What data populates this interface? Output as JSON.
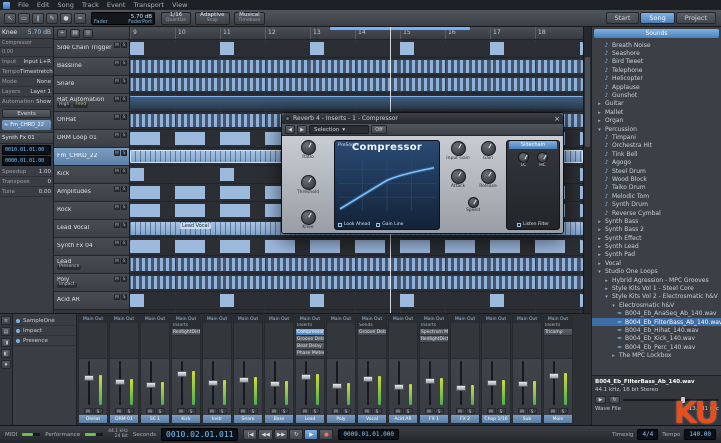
{
  "watermark": "KU",
  "menubar": {
    "items": [
      "File",
      "Edit",
      "Song",
      "Track",
      "Event",
      "Transport",
      "View"
    ]
  },
  "toolbar": {
    "tools": [
      "↖",
      "▭",
      "∥",
      "✎",
      "●",
      "≈"
    ],
    "link_value": "5.70 dB",
    "link_line1": "Fader",
    "link_line2": "FaderPort",
    "quantize_value": "1/16",
    "quantize_label": "Quantize",
    "snap_value": "Adaptive",
    "snap_label": "Snap",
    "timebase_value": "Musical",
    "timebase_label": "Timebase",
    "right_tabs": [
      {
        "label": "Start"
      },
      {
        "label": "Song",
        "cls": "active"
      },
      {
        "label": "Project"
      }
    ]
  },
  "inspector": {
    "param_name": "Knee",
    "param_value": "5.70 dB",
    "device_name": "Compressor",
    "param_min": "0.00",
    "input_label": "Input",
    "input_value": "Input L+R",
    "tempo_label": "Tempo",
    "tempo_value": "Timestretch",
    "mode_label": "Mode",
    "mode_value": "None",
    "layers_label": "Layers",
    "layers_value": "Layer 1",
    "automation_label": "Automation",
    "automation_value": "Show",
    "events_button": "Events",
    "clip_name": "Fm_CHRD_22",
    "section2_title": "Synth Fx 01",
    "pos1": "0010.01.01.00",
    "pos2": "0000.01.01.00",
    "fields": [
      {
        "label": "Speedup",
        "value": "1.00"
      },
      {
        "label": "Transpose",
        "value": "0"
      },
      {
        "label": "Tune",
        "value": "0.00"
      }
    ]
  },
  "tracklist": {
    "tools": [
      "+",
      "▤",
      "◎"
    ],
    "tracks": [
      {
        "name": "Side Chain Trigger",
        "cls": "patD"
      },
      {
        "name": "Bassline",
        "cls": "patA"
      },
      {
        "name": "Snare",
        "cls": "patA"
      },
      {
        "name": "Hat Automation",
        "badge": "High",
        "badge2": "Feed",
        "cls": "patE"
      },
      {
        "name": "OhHat",
        "cls": "patA"
      },
      {
        "name": "DRM Loop 01",
        "cls": "patB"
      },
      {
        "name": "Fm_CHRD_22",
        "cls": "patC selected"
      },
      {
        "name": "Kick",
        "cls": "patD"
      },
      {
        "name": "Amplitudes",
        "cls": "patB"
      },
      {
        "name": "Rock",
        "cls": "patB"
      },
      {
        "name": "Lead Vocal",
        "cls": "patC"
      },
      {
        "name": "Synth Fx 04",
        "cls": "patB"
      },
      {
        "name": "Lead",
        "badge": "Presence",
        "cls": "patA"
      },
      {
        "name": "Poly",
        "badge": "Impact",
        "cls": "patA"
      },
      {
        "name": "Acid AR",
        "cls": "patD"
      }
    ]
  },
  "ruler": [
    "9",
    "10",
    "11",
    "12",
    "13",
    "14",
    "15",
    "16",
    "17",
    "18"
  ],
  "arrange": {
    "clip_label": "Lead Vocal"
  },
  "plugin": {
    "title": "Reverb 4 - Inserts - 1 - Compressor",
    "preset": "Selection",
    "bypass": "Off",
    "brand": "PreSonus",
    "name": "Compressor",
    "knobs_left": [
      {
        "label": "Ratio"
      },
      {
        "label": "Threshold"
      },
      {
        "label": "Knee"
      }
    ],
    "knobs_right": [
      {
        "label": "Input Gain"
      },
      {
        "label": "Gain"
      },
      {
        "label": "Attack"
      },
      {
        "label": "Release"
      }
    ],
    "speed_label": "Speed",
    "options": [
      {
        "label": "Look Ahead"
      },
      {
        "label": "Gain Line"
      }
    ],
    "sidechain": {
      "title": "Sidechain",
      "knobs": [
        {
          "label": "LC"
        },
        {
          "label": "HC"
        }
      ],
      "listen": "Listen Filter"
    }
  },
  "browser": {
    "title": "Sounds",
    "items": [
      {
        "label": "Breath Noise",
        "cls": "sound ind1"
      },
      {
        "label": "Seashore",
        "cls": "sound ind1"
      },
      {
        "label": "Bird Tweet",
        "cls": "sound ind1"
      },
      {
        "label": "Telephone",
        "cls": "sound ind1"
      },
      {
        "label": "Helicopter",
        "cls": "sound ind1"
      },
      {
        "label": "Applause",
        "cls": "sound ind1"
      },
      {
        "label": "Gunshot",
        "cls": "sound ind1"
      },
      {
        "label": "Guitar",
        "cls": "folder ind0"
      },
      {
        "label": "Mallet",
        "cls": "folder ind0"
      },
      {
        "label": "Organ",
        "cls": "folder ind0"
      },
      {
        "label": "Percussion",
        "cls": "folder open ind0"
      },
      {
        "label": "Timpani",
        "cls": "sound ind1"
      },
      {
        "label": "Orchestra Hit",
        "cls": "sound ind1"
      },
      {
        "label": "Tink Bell",
        "cls": "sound ind1"
      },
      {
        "label": "Agogo",
        "cls": "sound ind1"
      },
      {
        "label": "Steel Drum",
        "cls": "sound ind1"
      },
      {
        "label": "Wood Block",
        "cls": "sound ind1"
      },
      {
        "label": "Taiko Drum",
        "cls": "sound ind1"
      },
      {
        "label": "Melodic Tom",
        "cls": "sound ind1"
      },
      {
        "label": "Synth Drum",
        "cls": "sound ind1"
      },
      {
        "label": "Reverse Cymbal",
        "cls": "sound ind1"
      },
      {
        "label": "Synth Bass",
        "cls": "folder ind0"
      },
      {
        "label": "Synth Bass 2",
        "cls": "folder ind0"
      },
      {
        "label": "Synth Effect",
        "cls": "folder ind0"
      },
      {
        "label": "Synth Lead",
        "cls": "folder ind0"
      },
      {
        "label": "Synth Pad",
        "cls": "folder ind0"
      },
      {
        "label": "Vocal",
        "cls": "folder ind0"
      },
      {
        "label": "Studio One Loops",
        "cls": "folder open ind0"
      },
      {
        "label": "Hybrid Agression - MPC Grooves",
        "cls": "folder ind1"
      },
      {
        "label": "Style Kits Vol 1 - Steel Core",
        "cls": "folder ind1"
      },
      {
        "label": "Style Kits Vol 2 - Electrosmatic h&V",
        "cls": "folder open ind1"
      },
      {
        "label": "Electrosmatic h&V",
        "cls": "folder open ind2"
      },
      {
        "label": "B004_Eb_AnaSeq_Ab_140.wav",
        "cls": "wave ind3"
      },
      {
        "label": "B004_Eb_FilterBass_Ab_140.wav",
        "cls": "wave ind3 selected"
      },
      {
        "label": "B004_Eb_Hihat_140.wav",
        "cls": "wave ind3"
      },
      {
        "label": "B004_Eb_Kick_140.wav",
        "cls": "wave ind3"
      },
      {
        "label": "B004_Eb_Perc_140.wav",
        "cls": "wave ind3"
      },
      {
        "label": "The MPC Lockbox",
        "cls": "folder ind2"
      }
    ],
    "file_info": {
      "name": "B004_Eb_FilterBass_Ab_140.wav",
      "format": "44.1 kHz, 16 bit Stereo",
      "type": "Wave File",
      "duration": "13.731 sec"
    }
  },
  "mixer": {
    "out_label": "Main Out",
    "m_label": "M",
    "s_label": "S",
    "side_icons": [
      "≡",
      "▤",
      "◨",
      "◧",
      "♦"
    ],
    "bank": [
      {
        "label": "SampleOne"
      },
      {
        "label": "Impact"
      },
      {
        "label": "Presence"
      }
    ],
    "channels": [
      {
        "name": "OhHat",
        "v": 62
      },
      {
        "name": "DRM 01",
        "v": 55
      },
      {
        "name": "SC 1",
        "v": 48
      },
      {
        "name": "Kick",
        "v": 70,
        "rack_header": "Inserts",
        "inserts": [
          {
            "label": "RedlightDist"
          }
        ]
      },
      {
        "name": "Instr",
        "v": 52
      },
      {
        "name": "Snare",
        "v": 58
      },
      {
        "name": "Bass",
        "v": 50
      },
      {
        "name": "Lead",
        "v": 64,
        "rack_header": "Inserts",
        "inserts": [
          {
            "label": "Compressor",
            "cls": "sel"
          },
          {
            "label": "Groove Delay"
          },
          {
            "label": "Beat Delay"
          },
          {
            "label": "Phase Meter"
          }
        ]
      },
      {
        "name": "Poly",
        "v": 46
      },
      {
        "name": "Vocal",
        "v": 60,
        "rack_header": "Sends",
        "inserts": [
          {
            "label": "Groove Delay"
          }
        ]
      },
      {
        "name": "Acid AR",
        "v": 44
      },
      {
        "name": "FX 1",
        "v": 57,
        "rack_header": "Inserts",
        "inserts": [
          {
            "label": "Spectrum Meter"
          },
          {
            "label": "RedlightDist"
          }
        ]
      },
      {
        "name": "FX 2",
        "v": 41
      },
      {
        "name": "Chop 1/16",
        "v": 53
      },
      {
        "name": "Sub",
        "v": 49
      },
      {
        "name": "Main",
        "v": 66,
        "rack_header": "Inserts",
        "inserts": [
          {
            "label": "Tricomp"
          }
        ]
      }
    ]
  },
  "statusbar": {
    "midi_label": "MIDI",
    "perf_label": "Performance",
    "rate": "44.1 kHz",
    "bits": "24 Bit",
    "unit": "Seconds",
    "time_main": "0010.02.01.011",
    "transport": [
      {
        "g": "|◀"
      },
      {
        "g": "◀◀"
      },
      {
        "g": "▶▶"
      },
      {
        "g": "↻"
      },
      {
        "g": "▶",
        "cls": "play"
      },
      {
        "g": "●",
        "cls": "rec"
      }
    ],
    "time_alt": "0009.01.01.000",
    "timesig_label": "Timesig",
    "timesig_value": "4/4",
    "tempo_label": "Tempo",
    "tempo_value": "140.00"
  }
}
